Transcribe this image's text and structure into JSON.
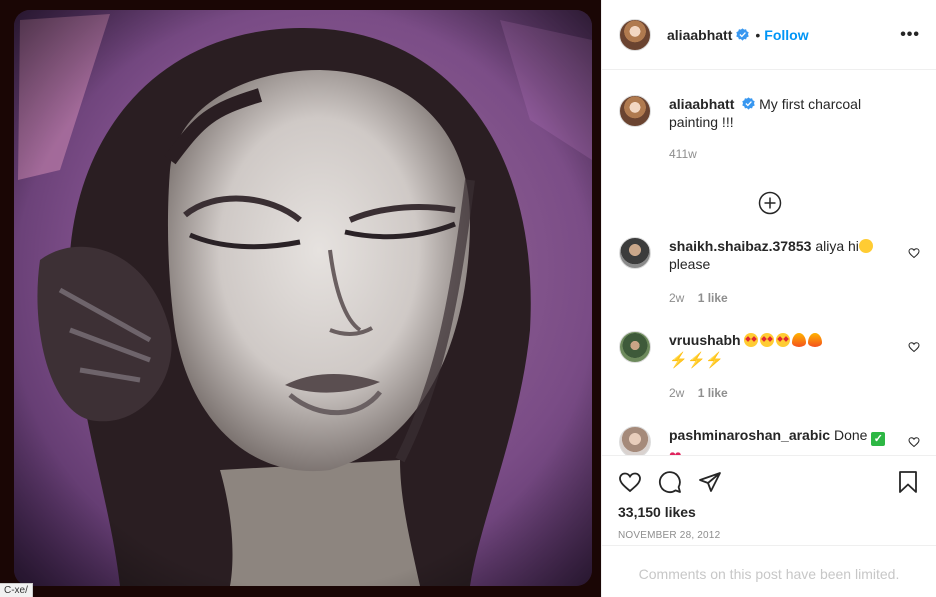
{
  "post": {
    "username": "aliaabhatt",
    "follow_label": "Follow",
    "more_label": "•••",
    "caption_text": "My first charcoal painting !!!",
    "caption_age": "411w",
    "likes": "33,150 likes",
    "date": "NOVEMBER 28, 2012",
    "limited_notice": "Comments on this post have been limited."
  },
  "comments": [
    {
      "user": "shaikh.shaibaz.37853",
      "text": "aliya hi",
      "text2": "please",
      "age": "2w",
      "likes": "1 like"
    },
    {
      "user": "vruushabh",
      "age": "2w",
      "likes": "1 like"
    },
    {
      "user": "pashminaroshan_arabic",
      "text": "Done"
    }
  ],
  "status_url": "C-xe/",
  "colors": {
    "link_blue": "#0095f6",
    "verified_blue": "#3897f0",
    "muted": "#8e8e8e",
    "border": "#efefef"
  },
  "icons": {
    "actions": [
      "heart-icon",
      "comment-icon",
      "share-icon"
    ],
    "save": "bookmark-icon",
    "load_more": "plus-circle-icon"
  }
}
